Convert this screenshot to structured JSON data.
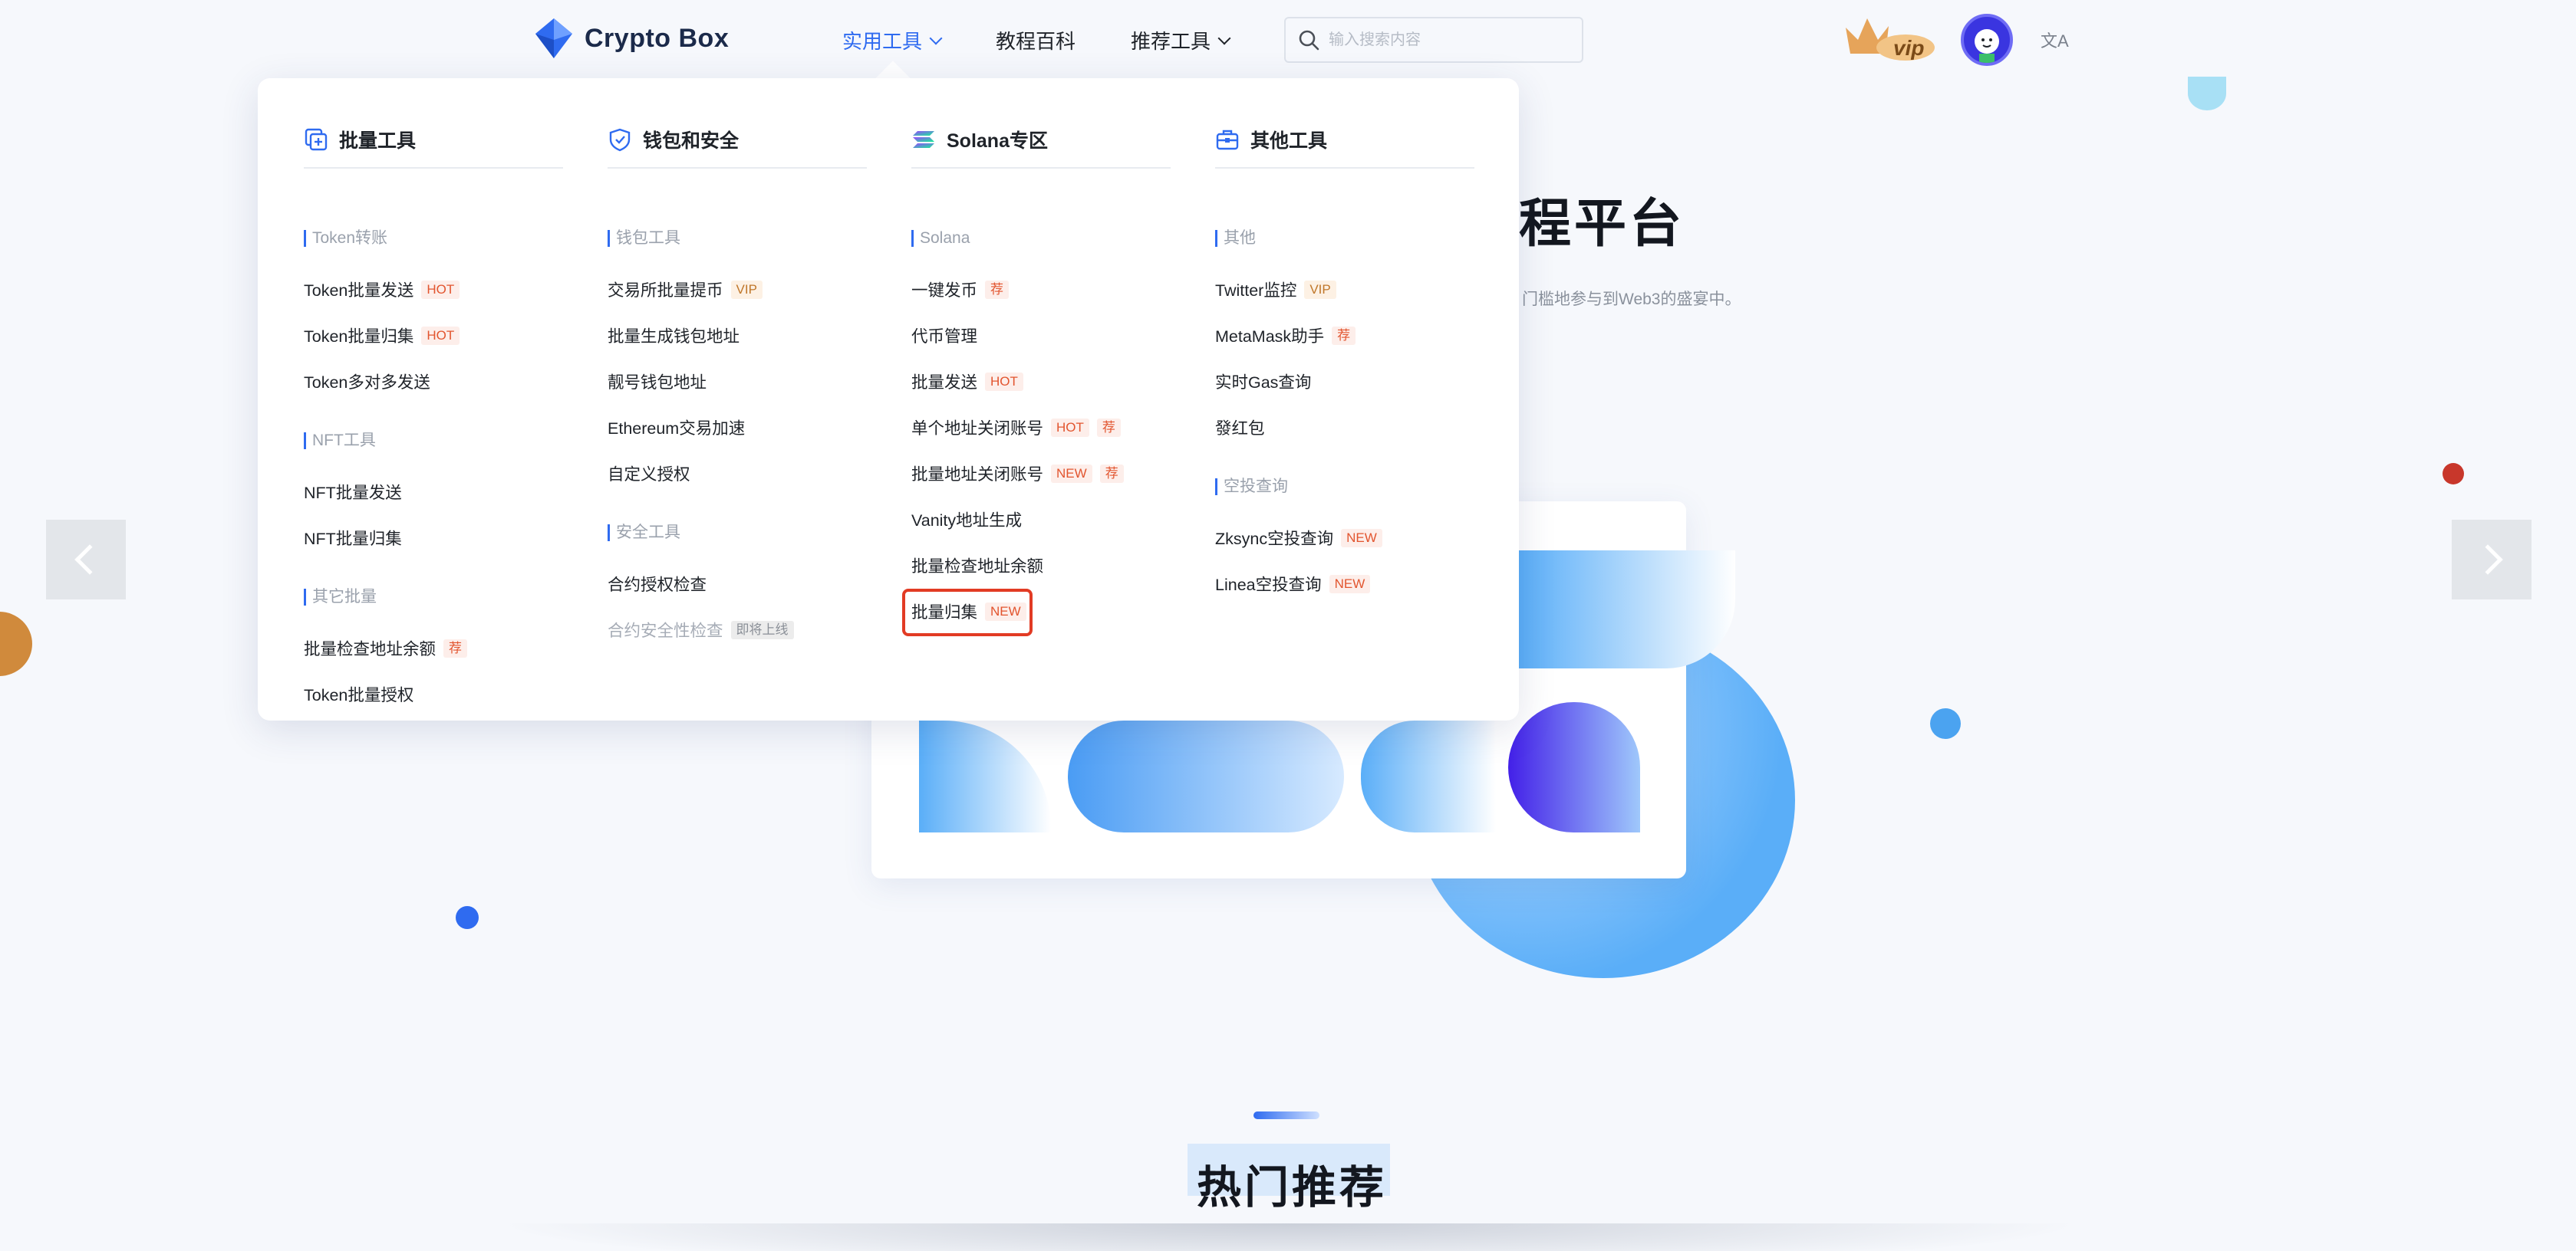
{
  "brand": {
    "name": "Crypto Box"
  },
  "nav": [
    {
      "label": "实用工具",
      "active": true,
      "has_menu": true
    },
    {
      "label": "教程百科",
      "active": false,
      "has_menu": false
    },
    {
      "label": "推荐工具",
      "active": false,
      "has_menu": true
    }
  ],
  "search": {
    "placeholder": "输入搜索内容"
  },
  "header_extras": {
    "vip_label": "vip",
    "lang_icon": "translate-icon"
  },
  "hero": {
    "title_partial": "程平台",
    "subtitle_partial": "门槛地参与到Web3的盛宴中。"
  },
  "section": {
    "title": "热门推荐"
  },
  "colors": {
    "accent": "#2f6bf0",
    "hot": "#e2552f",
    "vip": "#c0772a",
    "highlight": "#e23b24"
  },
  "dropdown": {
    "columns": [
      {
        "title": "批量工具",
        "icon": "batch-icon",
        "groups": [
          {
            "label": "Token转账",
            "items": [
              {
                "label": "Token批量发送",
                "badges": [
                  "HOT"
                ]
              },
              {
                "label": "Token批量归集",
                "badges": [
                  "HOT"
                ]
              },
              {
                "label": "Token多对多发送",
                "badges": []
              }
            ]
          },
          {
            "label": "NFT工具",
            "items": [
              {
                "label": "NFT批量发送",
                "badges": []
              },
              {
                "label": "NFT批量归集",
                "badges": []
              }
            ]
          },
          {
            "label": "其它批量",
            "items": [
              {
                "label": "批量检查地址余额",
                "badges": [
                  "荐"
                ]
              },
              {
                "label": "Token批量授权",
                "badges": []
              }
            ]
          }
        ]
      },
      {
        "title": "钱包和安全",
        "icon": "shield-icon",
        "groups": [
          {
            "label": "钱包工具",
            "items": [
              {
                "label": "交易所批量提币",
                "badges": [
                  "VIP"
                ]
              },
              {
                "label": "批量生成钱包地址",
                "badges": []
              },
              {
                "label": "靓号钱包地址",
                "badges": []
              },
              {
                "label": "Ethereum交易加速",
                "badges": []
              },
              {
                "label": "自定义授权",
                "badges": []
              }
            ]
          },
          {
            "label": "安全工具",
            "items": [
              {
                "label": "合约授权检查",
                "badges": []
              },
              {
                "label": "合约安全性检查",
                "badges": [
                  "即将上线"
                ],
                "disabled": true
              }
            ]
          }
        ]
      },
      {
        "title": "Solana专区",
        "icon": "solana-icon",
        "groups": [
          {
            "label": "Solana",
            "items": [
              {
                "label": "一键发币",
                "badges": [
                  "荐"
                ]
              },
              {
                "label": "代币管理",
                "badges": []
              },
              {
                "label": "批量发送",
                "badges": [
                  "HOT"
                ]
              },
              {
                "label": "单个地址关闭账号",
                "badges": [
                  "HOT",
                  "荐"
                ]
              },
              {
                "label": "批量地址关闭账号",
                "badges": [
                  "NEW",
                  "荐"
                ]
              },
              {
                "label": "Vanity地址生成",
                "badges": []
              },
              {
                "label": "批量检查地址余额",
                "badges": []
              },
              {
                "label": "批量归集",
                "badges": [
                  "NEW"
                ],
                "highlighted": true
              }
            ]
          }
        ]
      },
      {
        "title": "其他工具",
        "icon": "toolbox-icon",
        "groups": [
          {
            "label": "其他",
            "items": [
              {
                "label": "Twitter监控",
                "badges": [
                  "VIP"
                ]
              },
              {
                "label": "MetaMask助手",
                "badges": [
                  "荐"
                ]
              },
              {
                "label": "实时Gas查询",
                "badges": []
              },
              {
                "label": "發红包",
                "badges": []
              }
            ]
          },
          {
            "label": "空投查询",
            "items": [
              {
                "label": "Zksync空投查询",
                "badges": [
                  "NEW"
                ]
              },
              {
                "label": "Linea空投查询",
                "badges": [
                  "NEW"
                ]
              }
            ]
          }
        ]
      }
    ]
  }
}
